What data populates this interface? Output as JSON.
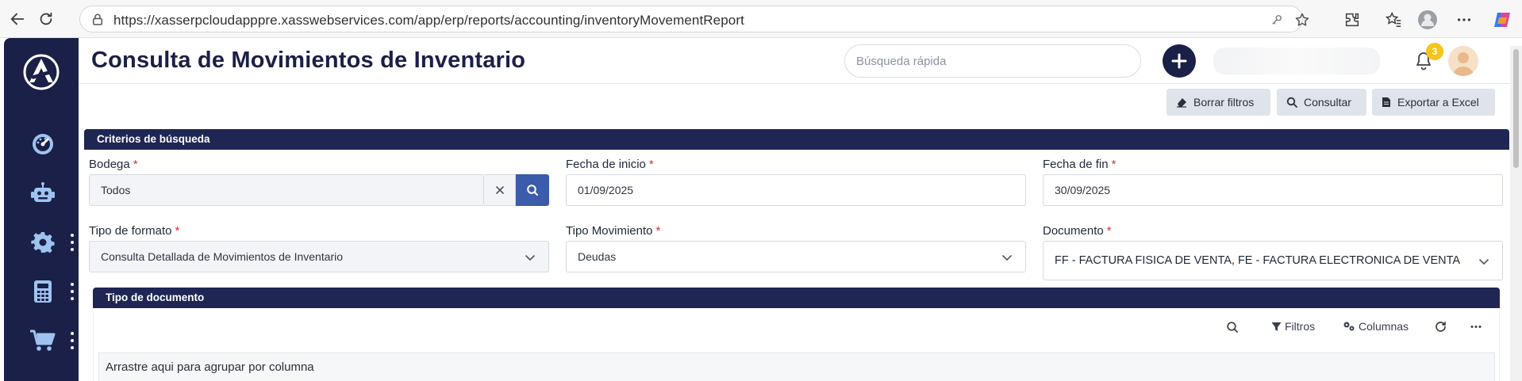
{
  "browser": {
    "url": "https://xasserpcloudapppre.xasswebservices.com/app/erp/reports/accounting/inventoryMovementReport"
  },
  "header": {
    "title": "Consulta de Movimientos de Inventario",
    "search_placeholder": "Búsqueda rápida",
    "notification_count": "3"
  },
  "toolbar": {
    "clear_filters": "Borrar filtros",
    "query": "Consultar",
    "export_excel": "Exportar a Excel"
  },
  "criteria": {
    "section_title": "Criterios de búsqueda",
    "bodega": {
      "label": "Bodega",
      "required": "*",
      "value": "Todos"
    },
    "fecha_inicio": {
      "label": "Fecha de inicio",
      "required": "*",
      "value": "01/09/2025"
    },
    "fecha_fin": {
      "label": "Fecha de fin",
      "required": "*",
      "value": "30/09/2025"
    },
    "tipo_formato": {
      "label": "Tipo de formato",
      "required": "*",
      "value": "Consulta Detallada de Movimientos de Inventario"
    },
    "tipo_movimiento": {
      "label": "Tipo Movimiento",
      "required": "*",
      "value": "Deudas"
    },
    "documento": {
      "label": "Documento",
      "required": "*",
      "value": "FF - FACTURA FISICA DE VENTA, FE - FACTURA ELECTRONICA DE VENTA"
    }
  },
  "document_type": {
    "section_title": "Tipo de documento",
    "filters_label": "Filtros",
    "columns_label": "Columnas",
    "group_hint": "Arrastre aqui para agrupar por columna"
  },
  "colors": {
    "sidebar": "#1a2047",
    "band": "#1f2654",
    "accent_blue": "#3b5bab",
    "badge": "#f5c518",
    "required": "#d32f2f"
  },
  "icons": {
    "sidebar": [
      "dashboard-icon",
      "robot-icon",
      "gear-icon",
      "calculator-icon",
      "cart-icon"
    ]
  }
}
